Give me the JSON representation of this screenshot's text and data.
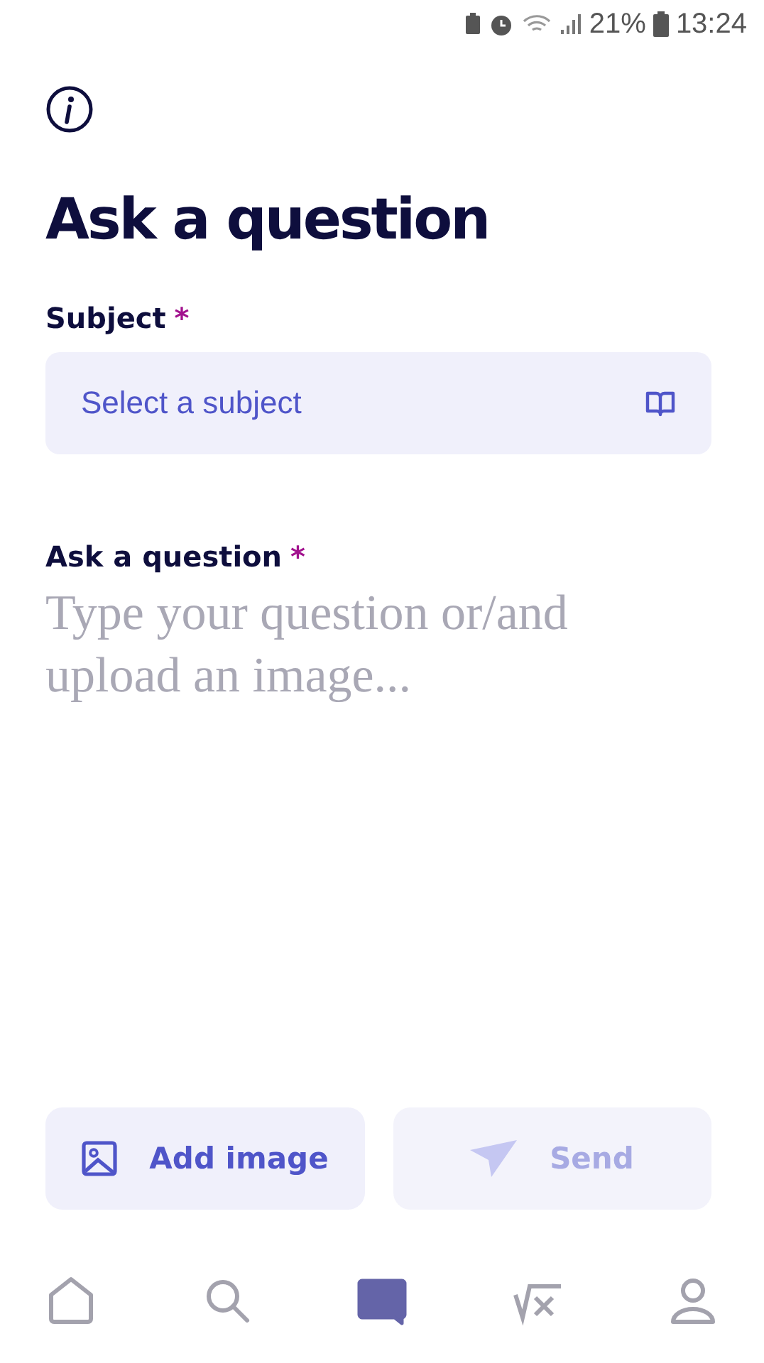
{
  "status_bar": {
    "battery_percent": "21%",
    "time": "13:24"
  },
  "title": "Ask a question",
  "subject": {
    "label": "Subject",
    "required_mark": "*",
    "placeholder": "Select a subject"
  },
  "question": {
    "label": "Ask a question",
    "required_mark": "*",
    "placeholder": "Type your question or/and upload an image..."
  },
  "buttons": [
    {
      "kind": "image",
      "label": "Add image",
      "disabled": false
    },
    {
      "kind": "send",
      "label": "Send",
      "disabled": true
    }
  ],
  "bottom_nav": [
    {
      "kind": "home",
      "selected": false
    },
    {
      "kind": "search",
      "selected": false
    },
    {
      "kind": "chat",
      "selected": true
    },
    {
      "kind": "math",
      "selected": false
    },
    {
      "kind": "profile",
      "selected": false
    }
  ]
}
